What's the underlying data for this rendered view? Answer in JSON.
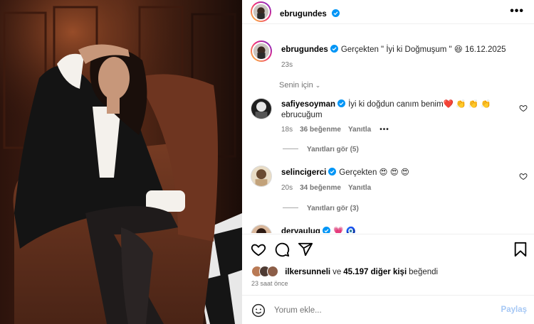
{
  "post": {
    "author": "ebrugundes",
    "caption": "Gerçekten \" İyi ki Doğmuşum \" 😆 16.12.2025",
    "time": "23s",
    "menu_glyph": "•••"
  },
  "comments_section": {
    "sort_label": "Senin için",
    "sort_chevron": "⌄",
    "items": [
      {
        "username": "safiyesoyman",
        "text": "İyi ki doğdun canım benim❤️ 👏 👏 👏 ebrucuğum",
        "time": "18s",
        "likes": "36 beğenme",
        "reply_label": "Yanıtla",
        "more": "•••",
        "view_replies": "Yanıtları gör (5)"
      },
      {
        "username": "selincigerci",
        "text": "Gerçekten 😍 😍 😍",
        "time": "20s",
        "likes": "34 beğenme",
        "reply_label": "Yanıtla",
        "view_replies": "Yanıtları gör (3)"
      },
      {
        "username": "deryauluq",
        "text": "💗 🧿"
      }
    ]
  },
  "likes_bar": {
    "user": "ilkersunneli",
    "connector": "ve",
    "others": "45.197 diğer kişi",
    "suffix": "beğendi",
    "time_ago": "23 saat önce"
  },
  "composer": {
    "placeholder": "Yorum ekle...",
    "post_label": "Paylaş"
  },
  "icons": [
    "verified-icon",
    "more-icon",
    "heart-icon",
    "comment-icon",
    "share-icon",
    "save-icon",
    "emoji-icon",
    "chevron-down-icon"
  ],
  "colors": {
    "verified": "#0095f6",
    "like_red": "#ed4956",
    "secondary_text": "#737373",
    "post_button_disabled": "#a6c8f5",
    "story_ring_start": "#f9ce34",
    "story_ring_end": "#6228d7"
  }
}
